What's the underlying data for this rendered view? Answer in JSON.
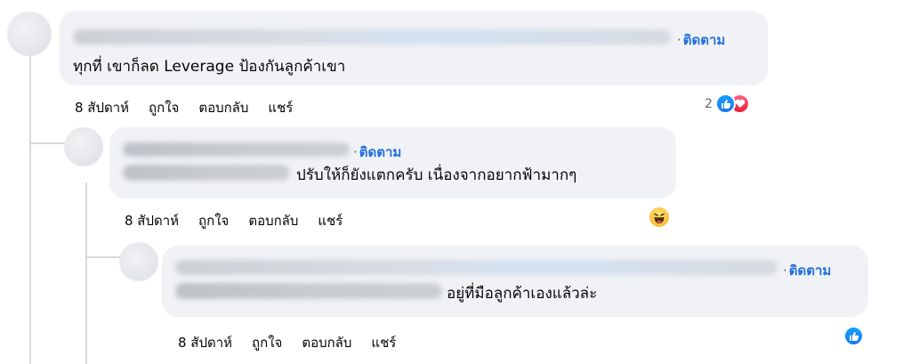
{
  "comments": [
    {
      "follow_label": "ติดตาม",
      "text": "ทุกที่ เขาก็ลด Leverage ป้องกันลูกค้าเขา",
      "time": "8 สัปดาห์",
      "like": "ถูกใจ",
      "reply": "ตอบกลับ",
      "share": "แชร์",
      "reaction_count": "2",
      "reactions": [
        "like-icon",
        "love-icon"
      ]
    },
    {
      "follow_label": "ติดตาม",
      "text": "ปรับให้ก็ยังแตกครับ เนื่องจากอยากฟ้ามากๆ",
      "time": "8 สัปดาห์",
      "like": "ถูกใจ",
      "reply": "ตอบกลับ",
      "share": "แชร์",
      "reactions": [
        "haha-icon"
      ]
    },
    {
      "follow_label": "ติดตาม",
      "text": "อยู่ที่มือลูกค้าเองแล้วล่ะ",
      "time": "8 สัปดาห์",
      "like": "ถูกใจ",
      "reply": "ตอบกลับ",
      "share": "แชร์",
      "reactions": [
        "like-icon"
      ]
    }
  ],
  "colors": {
    "bubble": "#f0f2f5",
    "follow_link": "#216fdb",
    "like_blue": "#1877f2",
    "love_red": "#e61e3c",
    "thread_line": "#d6d9de"
  }
}
